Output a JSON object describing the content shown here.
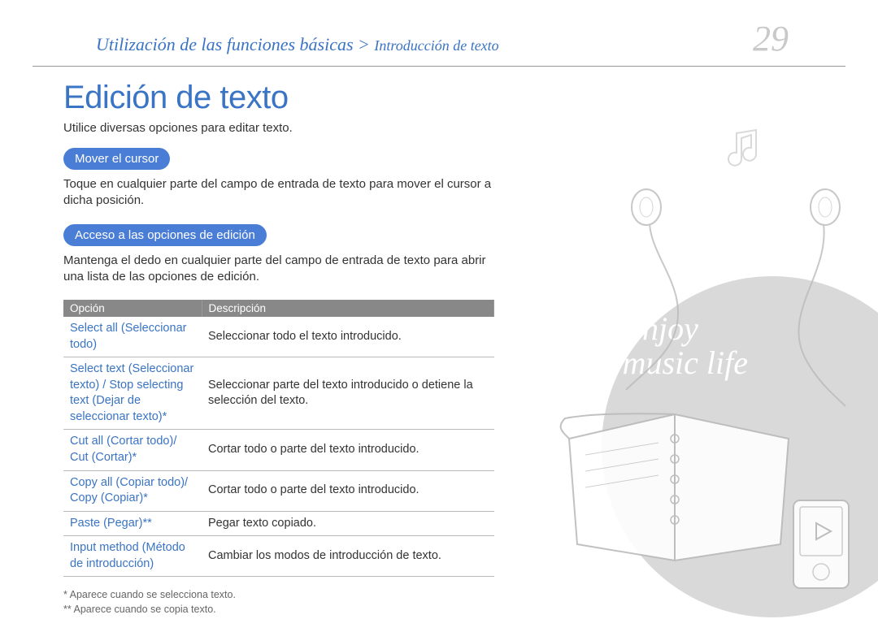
{
  "header": {
    "breadcrumb_main": "Utilización de las funciones básicas",
    "breadcrumb_sep": " > ",
    "breadcrumb_sub": "Introducción de texto",
    "page_number": "29"
  },
  "title": "Edición de texto",
  "intro": "Utilice diversas opciones para editar texto.",
  "section1": {
    "heading": "Mover el cursor",
    "body": "Toque en cualquier parte del campo de entrada de texto para mover el cursor a dicha posición."
  },
  "section2": {
    "heading": "Acceso a las opciones de edición",
    "body": "Mantenga el dedo en cualquier parte del campo de entrada de texto para abrir una lista de las opciones de edición."
  },
  "table": {
    "col1": "Opción",
    "col2": "Descripción",
    "rows": [
      {
        "opt": "Select all (Seleccionar todo)",
        "desc": "Seleccionar todo el texto introducido."
      },
      {
        "opt": "Select text (Seleccionar texto) / Stop selecting text (Dejar de seleccionar texto)*",
        "desc": "Seleccionar parte del texto introducido o detiene la selección del texto."
      },
      {
        "opt": "Cut all (Cortar todo)/ Cut (Cortar)*",
        "desc": "Cortar todo o parte del texto introducido."
      },
      {
        "opt": "Copy all (Copiar todo)/ Copy (Copiar)*",
        "desc": "Cortar todo o parte del texto introducido."
      },
      {
        "opt": "Paste (Pegar)**",
        "desc": "Pegar texto copiado."
      },
      {
        "opt": "Input method (Método de introducción)",
        "desc": "Cambiar los modos de introducción de texto."
      }
    ]
  },
  "footnotes": {
    "n1": "* Aparece cuando se selecciona texto.",
    "n2": "** Aparece cuando se copia texto."
  },
  "illustration": {
    "enjoy_line1": "Enjoy",
    "enjoy_line2": "music life"
  }
}
